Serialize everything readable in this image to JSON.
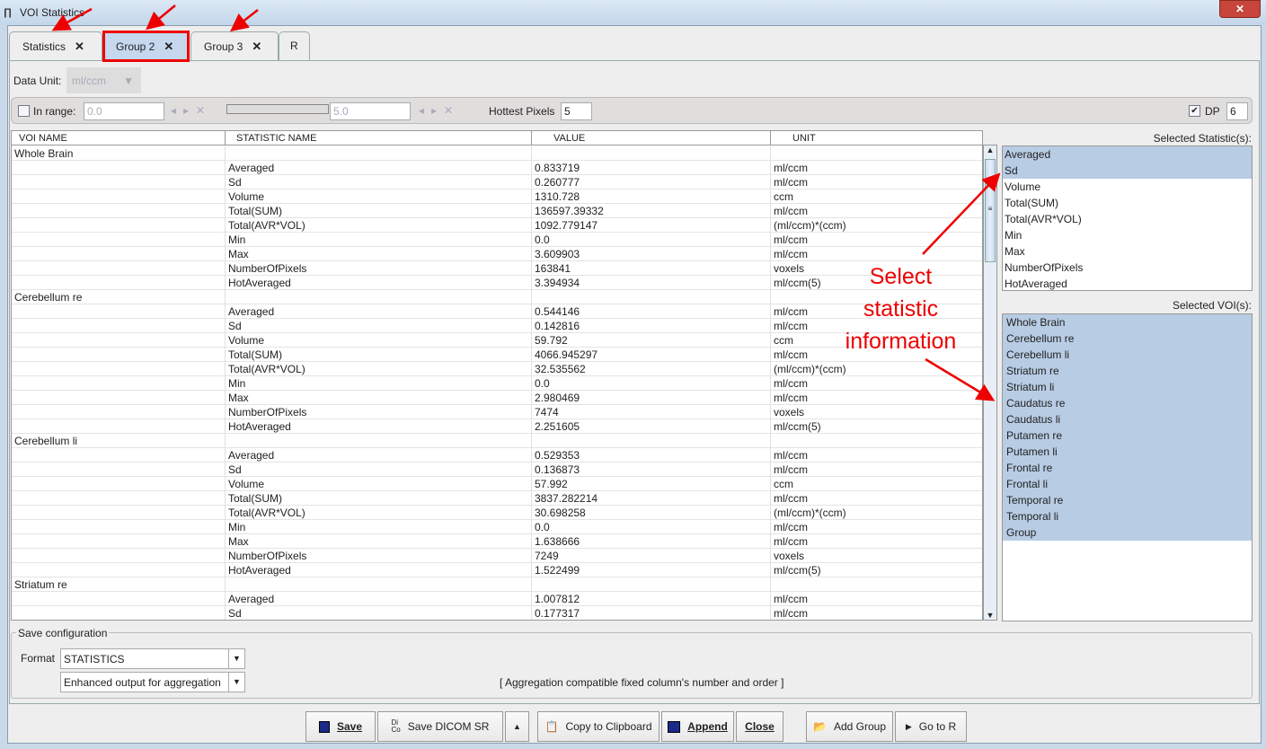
{
  "window": {
    "title": "VOI Statistics",
    "close": "✕"
  },
  "tabs": [
    {
      "label": "Statistics",
      "close": "✕"
    },
    {
      "label": "Group 2",
      "close": "✕"
    },
    {
      "label": "Group 3",
      "close": "✕"
    },
    {
      "label": "R"
    }
  ],
  "active_tab": "Group 2",
  "data_unit": {
    "label": "Data Unit:",
    "value": "ml/ccm"
  },
  "filter": {
    "in_range_label": "In range:",
    "in_range_checked": false,
    "min": "0.0",
    "max": "5.0",
    "hottest_label": "Hottest Pixels",
    "hottest": "5",
    "dp_label": "DP",
    "dp_checked": true,
    "dp": "6"
  },
  "table": {
    "headers": [
      "VOI NAME",
      "STATISTIC NAME",
      "VALUE",
      "UNIT"
    ],
    "groups": [
      {
        "voi": "Whole Brain",
        "rows": [
          [
            "Averaged",
            "0.833719",
            "ml/ccm"
          ],
          [
            "Sd",
            "0.260777",
            "ml/ccm"
          ],
          [
            "Volume",
            "1310.728",
            "ccm"
          ],
          [
            "Total(SUM)",
            "136597.39332",
            "ml/ccm"
          ],
          [
            "Total(AVR*VOL)",
            "1092.779147",
            "(ml/ccm)*(ccm)"
          ],
          [
            "Min",
            "0.0",
            "ml/ccm"
          ],
          [
            "Max",
            "3.609903",
            "ml/ccm"
          ],
          [
            "NumberOfPixels",
            "163841",
            "voxels"
          ],
          [
            "HotAveraged",
            "3.394934",
            "ml/ccm(5)"
          ]
        ]
      },
      {
        "voi": "Cerebellum re",
        "rows": [
          [
            "Averaged",
            "0.544146",
            "ml/ccm"
          ],
          [
            "Sd",
            "0.142816",
            "ml/ccm"
          ],
          [
            "Volume",
            "59.792",
            "ccm"
          ],
          [
            "Total(SUM)",
            "4066.945297",
            "ml/ccm"
          ],
          [
            "Total(AVR*VOL)",
            "32.535562",
            "(ml/ccm)*(ccm)"
          ],
          [
            "Min",
            "0.0",
            "ml/ccm"
          ],
          [
            "Max",
            "2.980469",
            "ml/ccm"
          ],
          [
            "NumberOfPixels",
            "7474",
            "voxels"
          ],
          [
            "HotAveraged",
            "2.251605",
            "ml/ccm(5)"
          ]
        ]
      },
      {
        "voi": "Cerebellum li",
        "rows": [
          [
            "Averaged",
            "0.529353",
            "ml/ccm"
          ],
          [
            "Sd",
            "0.136873",
            "ml/ccm"
          ],
          [
            "Volume",
            "57.992",
            "ccm"
          ],
          [
            "Total(SUM)",
            "3837.282214",
            "ml/ccm"
          ],
          [
            "Total(AVR*VOL)",
            "30.698258",
            "(ml/ccm)*(ccm)"
          ],
          [
            "Min",
            "0.0",
            "ml/ccm"
          ],
          [
            "Max",
            "1.638666",
            "ml/ccm"
          ],
          [
            "NumberOfPixels",
            "7249",
            "voxels"
          ],
          [
            "HotAveraged",
            "1.522499",
            "ml/ccm(5)"
          ]
        ]
      },
      {
        "voi": "Striatum re",
        "rows": [
          [
            "Averaged",
            "1.007812",
            "ml/ccm"
          ],
          [
            "Sd",
            "0.177317",
            "ml/ccm"
          ]
        ]
      }
    ]
  },
  "stats_panel": {
    "label": "Selected Statistic(s):",
    "items": [
      {
        "t": "Averaged",
        "s": true
      },
      {
        "t": "Sd",
        "s": true
      },
      {
        "t": "Volume",
        "s": false
      },
      {
        "t": "Total(SUM)",
        "s": false
      },
      {
        "t": "Total(AVR*VOL)",
        "s": false
      },
      {
        "t": "Min",
        "s": false
      },
      {
        "t": "Max",
        "s": false
      },
      {
        "t": "NumberOfPixels",
        "s": false
      },
      {
        "t": "HotAveraged",
        "s": false
      }
    ]
  },
  "voi_panel": {
    "label": "Selected VOI(s):",
    "items": [
      "Whole Brain",
      "Cerebellum re",
      "Cerebellum li",
      "Striatum re",
      "Striatum li",
      "Caudatus re",
      "Caudatus li",
      "Putamen re",
      "Putamen li",
      "Frontal re",
      "Frontal li",
      "Temporal re",
      "Temporal li",
      "Group"
    ]
  },
  "save_config": {
    "legend": "Save configuration",
    "format_label": "Format",
    "format": "STATISTICS",
    "output": "Enhanced output for aggregation",
    "note": "[ Aggregation compatible fixed column's number and order ]"
  },
  "buttons": {
    "save": "Save",
    "save_dicom": "Save DICOM SR",
    "copy": "Copy to Clipboard",
    "append": "Append",
    "close": "Close",
    "add_group": "Add Group",
    "go_r": "Go to R"
  },
  "annotation": {
    "text": [
      "Select",
      "statistic",
      "information"
    ],
    "color": "#ff0000"
  }
}
